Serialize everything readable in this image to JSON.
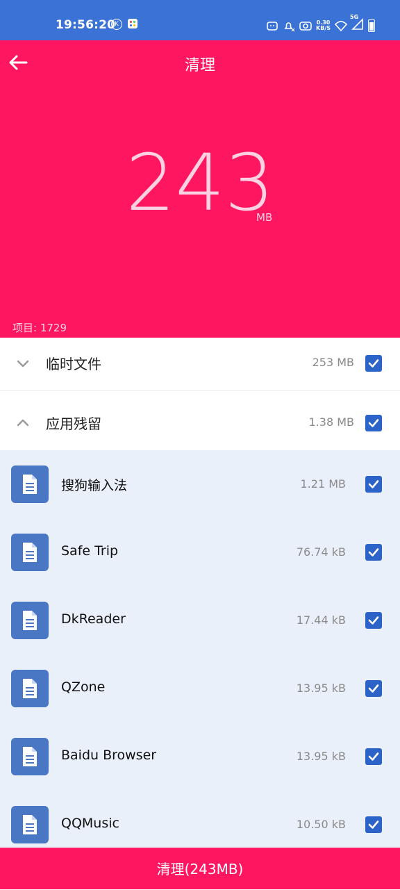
{
  "status_bar": {
    "time": "19:56:20",
    "net_speed_value": "0.30",
    "net_speed_unit": "KB/S",
    "network_type": "5G"
  },
  "header": {
    "title": "清理",
    "total_size_value": "243",
    "total_size_unit": "MB",
    "item_count_label": "项目: 1729"
  },
  "categories": [
    {
      "label": "临时文件",
      "size": "253 MB",
      "expanded": false,
      "checked": true
    },
    {
      "label": "应用残留",
      "size": "1.38 MB",
      "expanded": true,
      "checked": true
    }
  ],
  "apps": [
    {
      "name": "搜狗输入法",
      "size": "1.21 MB",
      "checked": true
    },
    {
      "name": "Safe Trip",
      "size": "76.74 kB",
      "checked": true
    },
    {
      "name": "DkReader",
      "size": "17.44 kB",
      "checked": true
    },
    {
      "name": "QZone",
      "size": "13.95 kB",
      "checked": true
    },
    {
      "name": "Baidu Browser",
      "size": "13.95 kB",
      "checked": true
    },
    {
      "name": "QQMusic",
      "size": "10.50 kB",
      "checked": true
    }
  ],
  "footer": {
    "clean_button_label": "清理(243MB)"
  },
  "colors": {
    "accent": "#fe1760",
    "status_bar": "#3a72d6",
    "checkbox": "#2b63c8",
    "list_bg": "#eaf0f9"
  }
}
